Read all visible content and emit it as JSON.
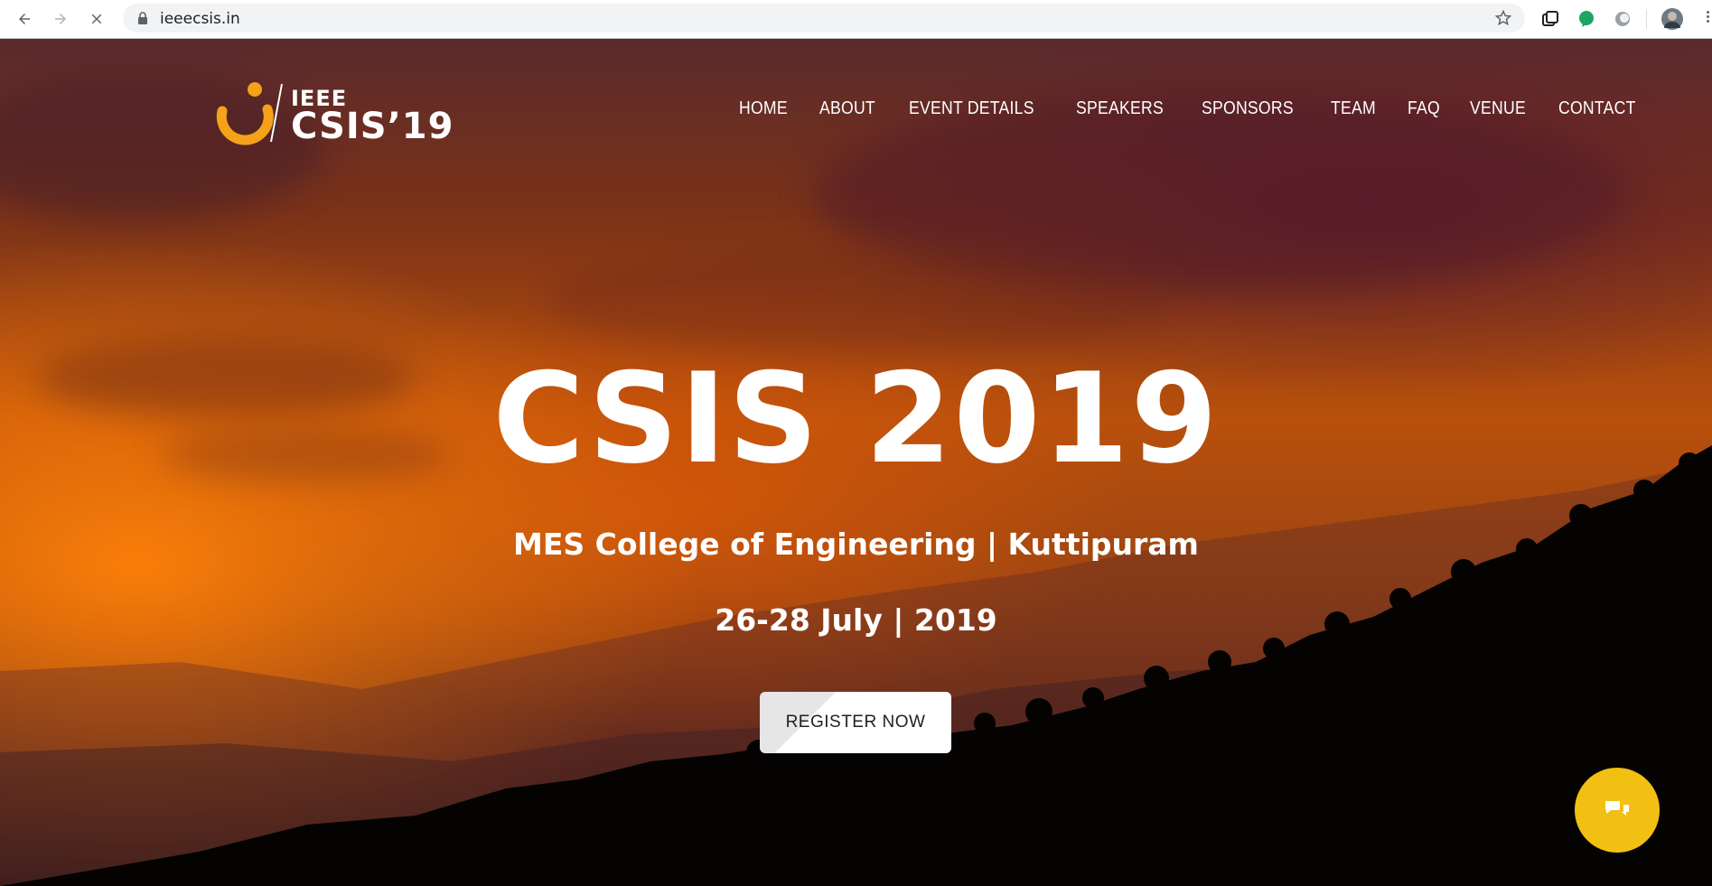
{
  "browser": {
    "url": "ieeecsis.in"
  },
  "site": {
    "logo_top": "IEEE",
    "logo_bottom": "CSIS’19",
    "menu": [
      "HOME",
      "ABOUT",
      "EVENT DETAILS",
      "SPEAKERS",
      "SPONSORS",
      "TEAM",
      "FAQ",
      "VENUE",
      "CONTACT"
    ]
  },
  "hero": {
    "title": "CSIS 2019",
    "venue": "MES College of Engineering | Kuttipuram",
    "dates": "26-28 July | 2019",
    "register_label": "REGISTER NOW"
  },
  "colors": {
    "accent_yellow": "#f2c012",
    "logo_orange": "#f5a11a"
  }
}
